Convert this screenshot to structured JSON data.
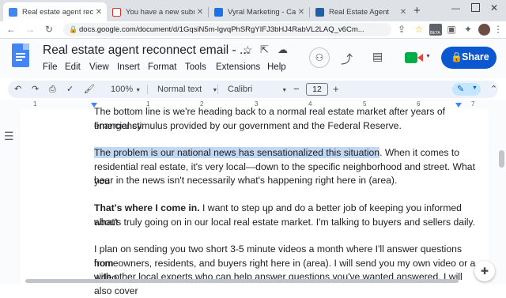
{
  "tabs": [
    {
      "title": "Real estate agent reconne",
      "favicon_color": "#4285f4",
      "active": true
    },
    {
      "title": "You have a new submissic",
      "favicon_color": "#d93025",
      "active": false
    },
    {
      "title": "Vyral Marketing - Calend",
      "favicon_color": "#1a73e8",
      "active": false
    },
    {
      "title": "Real Estate Agent",
      "favicon_color": "#1e5fa8",
      "active": false
    }
  ],
  "new_tab": "+",
  "url": "docs.google.com/document/d/1GqsiN5m-lgvqPhSRgYIFJ3bHJ4RabVL2LAQ_v6Cm...",
  "extension_badge": "BETA",
  "doc": {
    "title": "Real estate agent reconnect email - ...",
    "menu": [
      "File",
      "Edit",
      "View",
      "Insert",
      "Format",
      "Tools",
      "Extensions",
      "Help"
    ],
    "share_label": "Share"
  },
  "toolbar": {
    "zoom": "100%",
    "style": "Normal text",
    "font": "Calibri",
    "font_size": "12",
    "minus": "−",
    "plus": "+"
  },
  "ruler_numbers": [
    "1",
    "1",
    "2",
    "3",
    "4",
    "5",
    "6",
    "7"
  ],
  "paragraphs": {
    "p1_line1": "The bottom line is we're heading back to a normal real estate market after years of emergency",
    "p1_line2": "financial stimulus provided by our government and the Federal Reserve.",
    "p2_highlight": "The problem is our national news has sensationalized this situation",
    "p2_line1_rest": ". When it comes to",
    "p2_line2": "residential real estate, it's very local—down to the specific neighborhood and street. What you",
    "p2_line3": "hear in the news isn't necessarily what's happening right here in (area).",
    "p3_bold": "That's where I come in.",
    "p3_line1_rest": " I want to step up and do a better job of keeping you informed about",
    "p3_line2": "what's truly going on in our local real estate market. I'm talking to buyers and sellers daily.",
    "p4_line1": "I plan on sending you two short 3-5 minute videos a month where I'll answer questions from",
    "p4_line2": "homeowners, residents, and buyers right here in (area). I will send you my own video or a video",
    "p4_line3": "with other local experts who can help answer questions you've wanted answered. I will also cover"
  },
  "colors": {
    "share_bg": "#0b57d0",
    "highlight": "#c2d7f2",
    "docs_blue": "#4285f4"
  }
}
